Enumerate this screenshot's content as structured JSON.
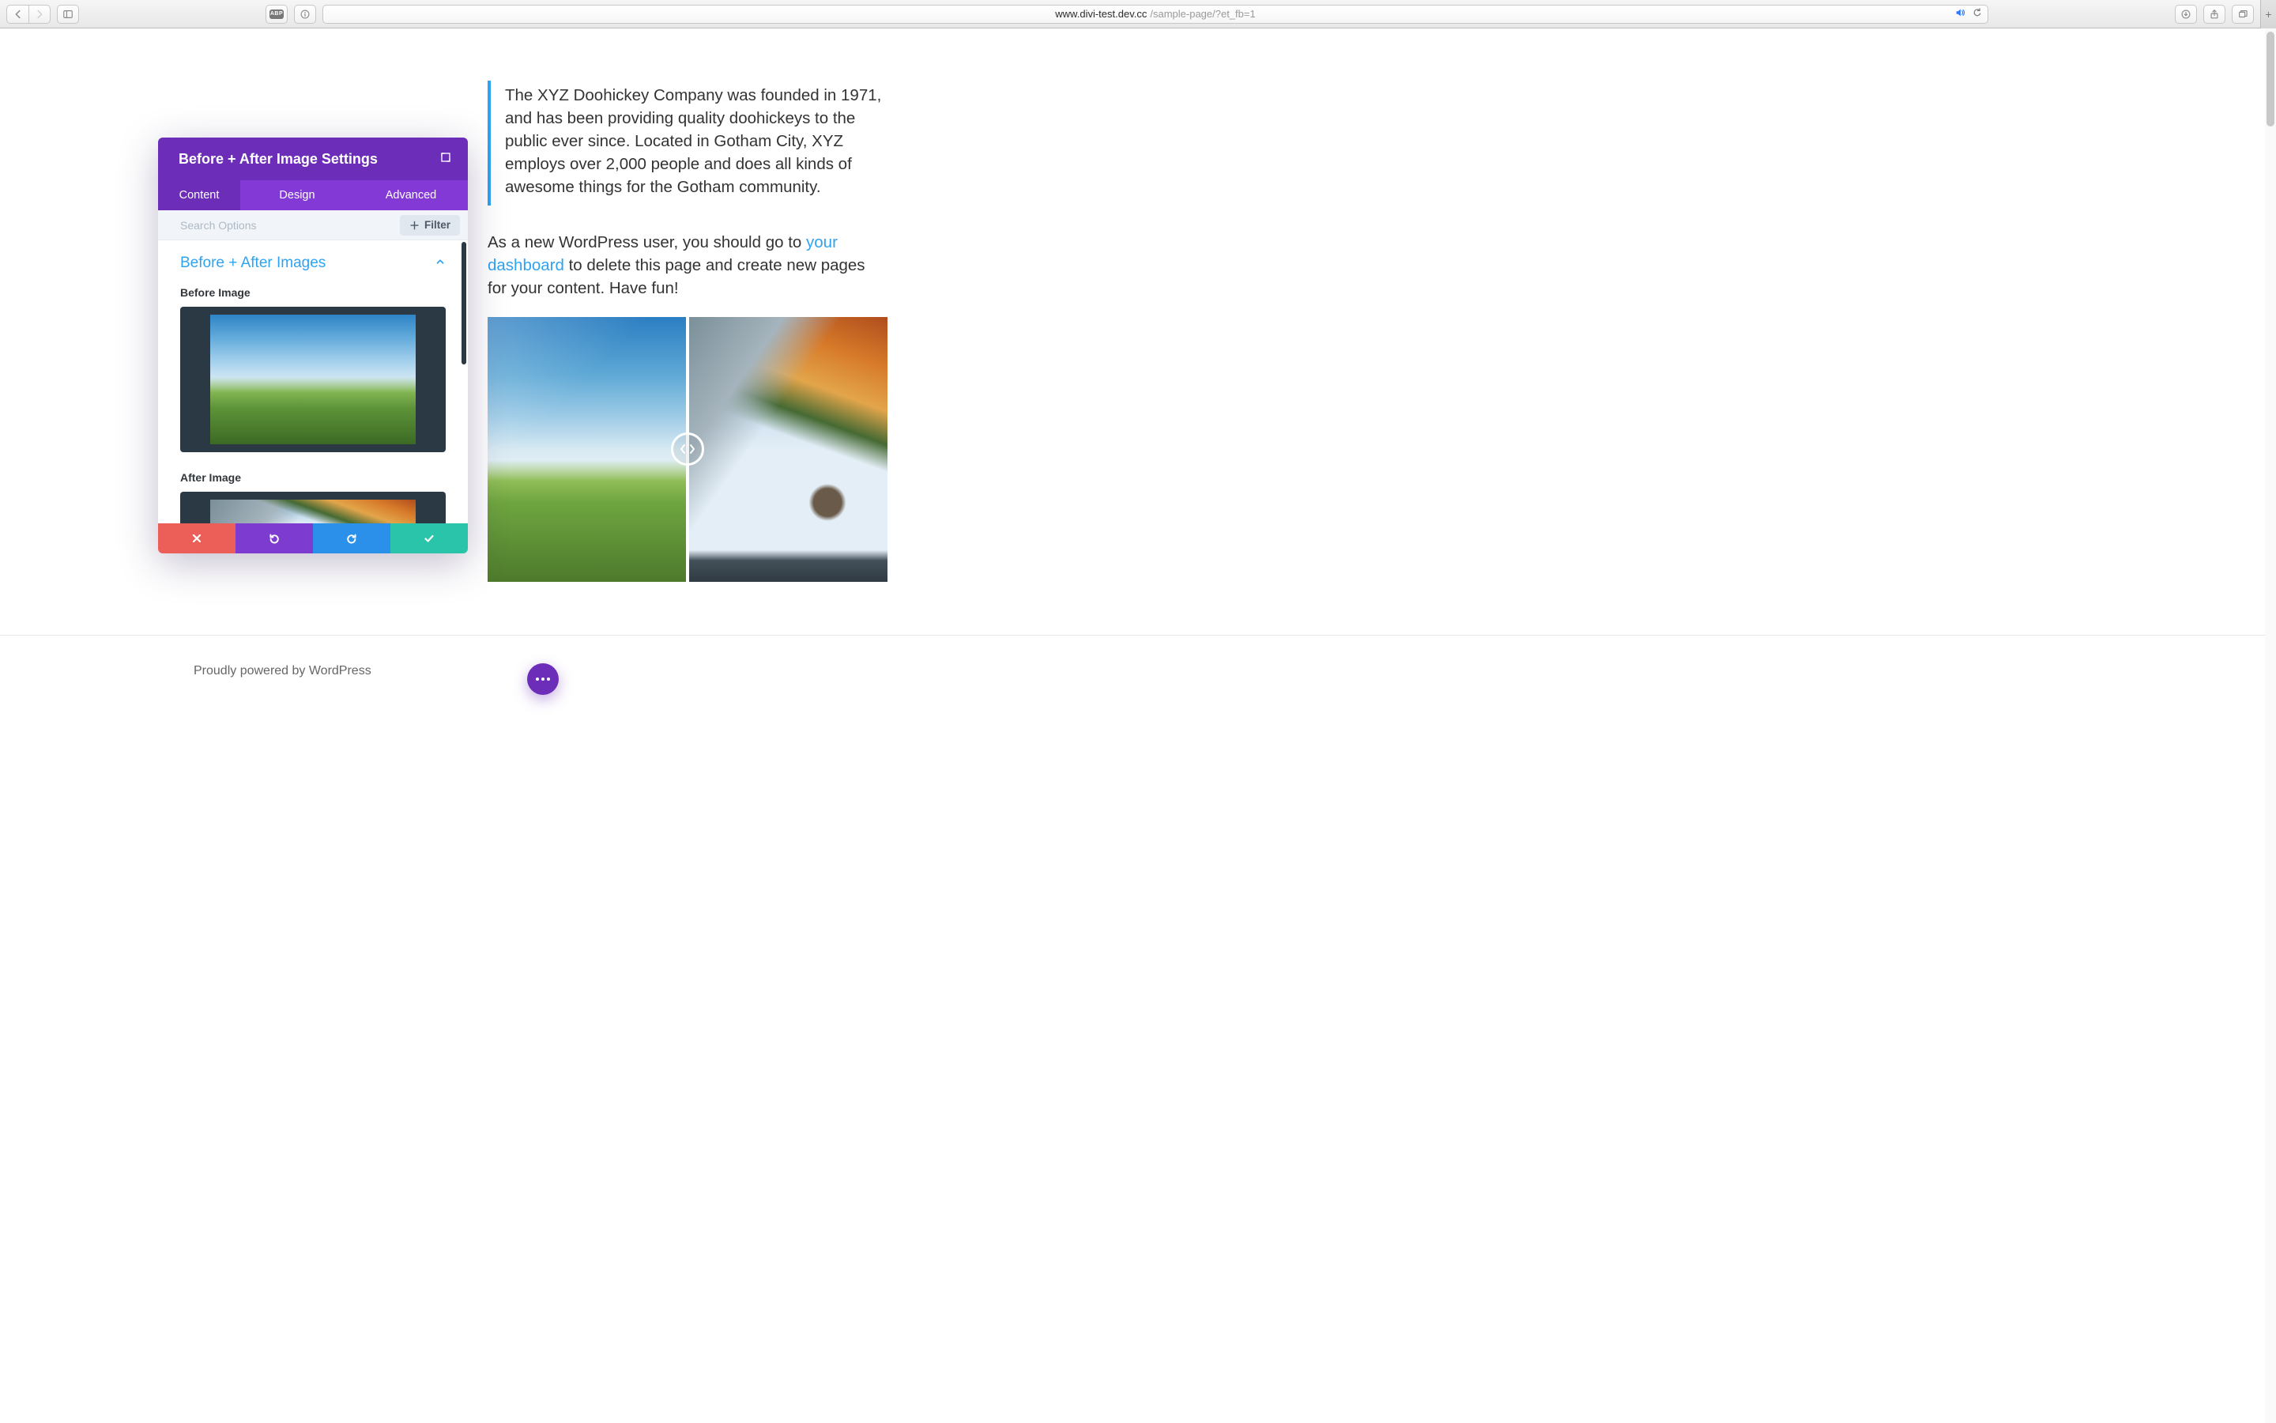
{
  "browser": {
    "url_host": "www.divi-test.dev.cc",
    "url_path": "/sample-page/?et_fb=1"
  },
  "page": {
    "blockquote": "The XYZ Doohickey Company was founded in 1971, and has been providing quality doohickeys to the public ever since. Located in Gotham City, XYZ employs over 2,000 people and does all kinds of awesome things for the Gotham community.",
    "para_before_link": "As a new WordPress user, you should go to ",
    "para_link": "your dashboard",
    "para_after_link": " to delete this page and create new pages for your content. Have fun!",
    "footer": "Proudly powered by WordPress"
  },
  "modal": {
    "title": "Before + After Image Settings",
    "tabs": {
      "content": "Content",
      "design": "Design",
      "advanced": "Advanced"
    },
    "search_placeholder": "Search Options",
    "filter_label": "Filter",
    "section_title": "Before + After Images",
    "before_label": "Before Image",
    "after_label": "After Image"
  }
}
